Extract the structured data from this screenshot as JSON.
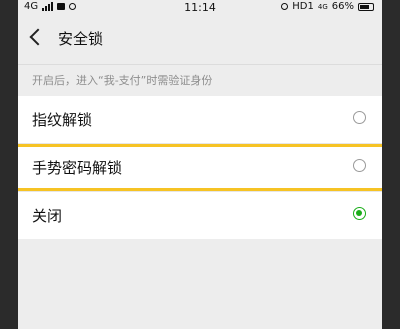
{
  "status_bar": {
    "network": "4G",
    "time": "11:14",
    "right_text": "HD1",
    "net_small": "4G",
    "battery": "66%"
  },
  "header": {
    "title": "安全锁"
  },
  "hint": "开启后，进入“我-支付”时需验证身份",
  "options": [
    {
      "label": "指纹解锁",
      "selected": false
    },
    {
      "label": "手势密码解锁",
      "selected": false,
      "highlighted": true
    },
    {
      "label": "关闭",
      "selected": true
    }
  ],
  "colors": {
    "accent_green": "#1aad19",
    "highlight_yellow": "#f6c324"
  }
}
